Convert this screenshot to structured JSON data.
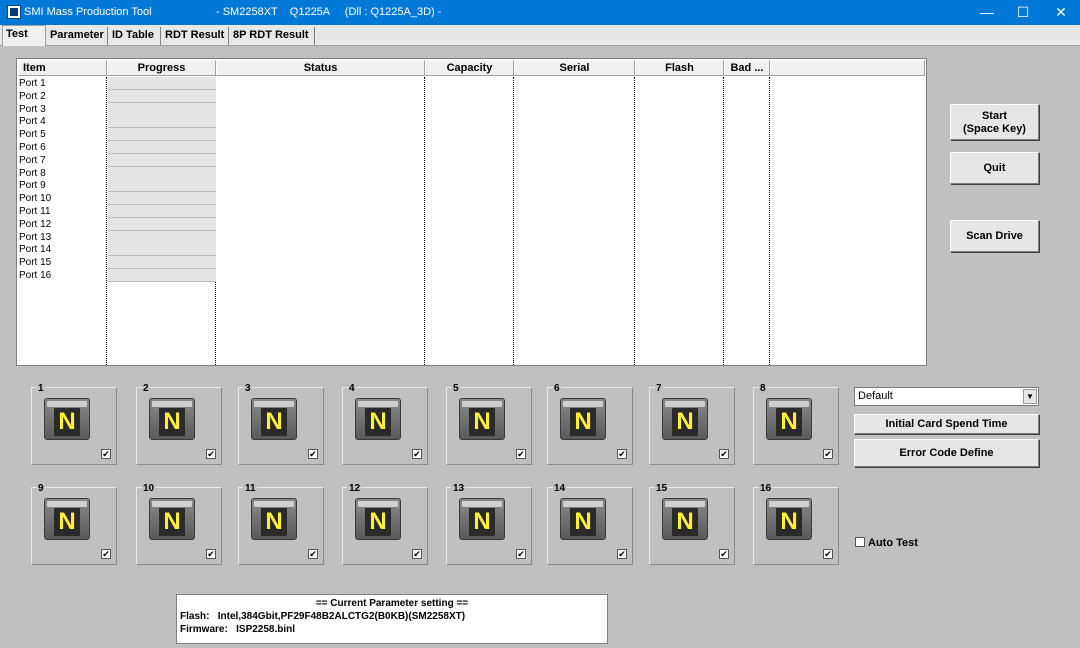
{
  "window": {
    "title": "SMI Mass Production Tool",
    "title_detail": "- SM2258XT    Q1225A     (Dll : Q1225A_3D) -",
    "min": "—",
    "max": "☐",
    "close": "✕"
  },
  "tabs": [
    "Test",
    "Parameter",
    "ID Table",
    "RDT Result",
    "8P RDT Result"
  ],
  "table": {
    "columns": [
      "Item",
      "Progress",
      "Status",
      "Capacity",
      "Serial",
      "Flash",
      "Bad ..."
    ],
    "rows": [
      "Port 1",
      "Port 2",
      "Port 3",
      "Port 4",
      "Port 5",
      "Port 6",
      "Port 7",
      "Port 8",
      "Port 9",
      "Port 10",
      "Port 11",
      "Port 12",
      "Port 13",
      "Port 14",
      "Port 15",
      "Port 16"
    ]
  },
  "buttons": {
    "start_line1": "Start",
    "start_line2": "(Space Key)",
    "quit": "Quit",
    "scan": "Scan Drive",
    "initial_card": "Initial Card Spend Time",
    "error_code": "Error Code Define"
  },
  "ports": [
    {
      "num": "1",
      "letter": "N",
      "check": "✔"
    },
    {
      "num": "2",
      "letter": "N",
      "check": "✔"
    },
    {
      "num": "3",
      "letter": "N",
      "check": "✔"
    },
    {
      "num": "4",
      "letter": "N",
      "check": "✔"
    },
    {
      "num": "5",
      "letter": "N",
      "check": "✔"
    },
    {
      "num": "6",
      "letter": "N",
      "check": "✔"
    },
    {
      "num": "7",
      "letter": "N",
      "check": "✔"
    },
    {
      "num": "8",
      "letter": "N",
      "check": "✔"
    },
    {
      "num": "9",
      "letter": "N",
      "check": "✔"
    },
    {
      "num": "10",
      "letter": "N",
      "check": "✔"
    },
    {
      "num": "11",
      "letter": "N",
      "check": "✔"
    },
    {
      "num": "12",
      "letter": "N",
      "check": "✔"
    },
    {
      "num": "13",
      "letter": "N",
      "check": "✔"
    },
    {
      "num": "14",
      "letter": "N",
      "check": "✔"
    },
    {
      "num": "15",
      "letter": "N",
      "check": "✔"
    },
    {
      "num": "16",
      "letter": "N",
      "check": "✔"
    }
  ],
  "mode_select": {
    "value": "Default",
    "arrow": "▼"
  },
  "auto_test": {
    "label": "Auto Test"
  },
  "params": {
    "header": "== Current Parameter setting ==",
    "flash": "Flash:   Intel,384Gbit,PF29F48B2ALCTG2(B0KB)(SM2258XT)",
    "firmware": "Firmware:   ISP2258.binl"
  }
}
